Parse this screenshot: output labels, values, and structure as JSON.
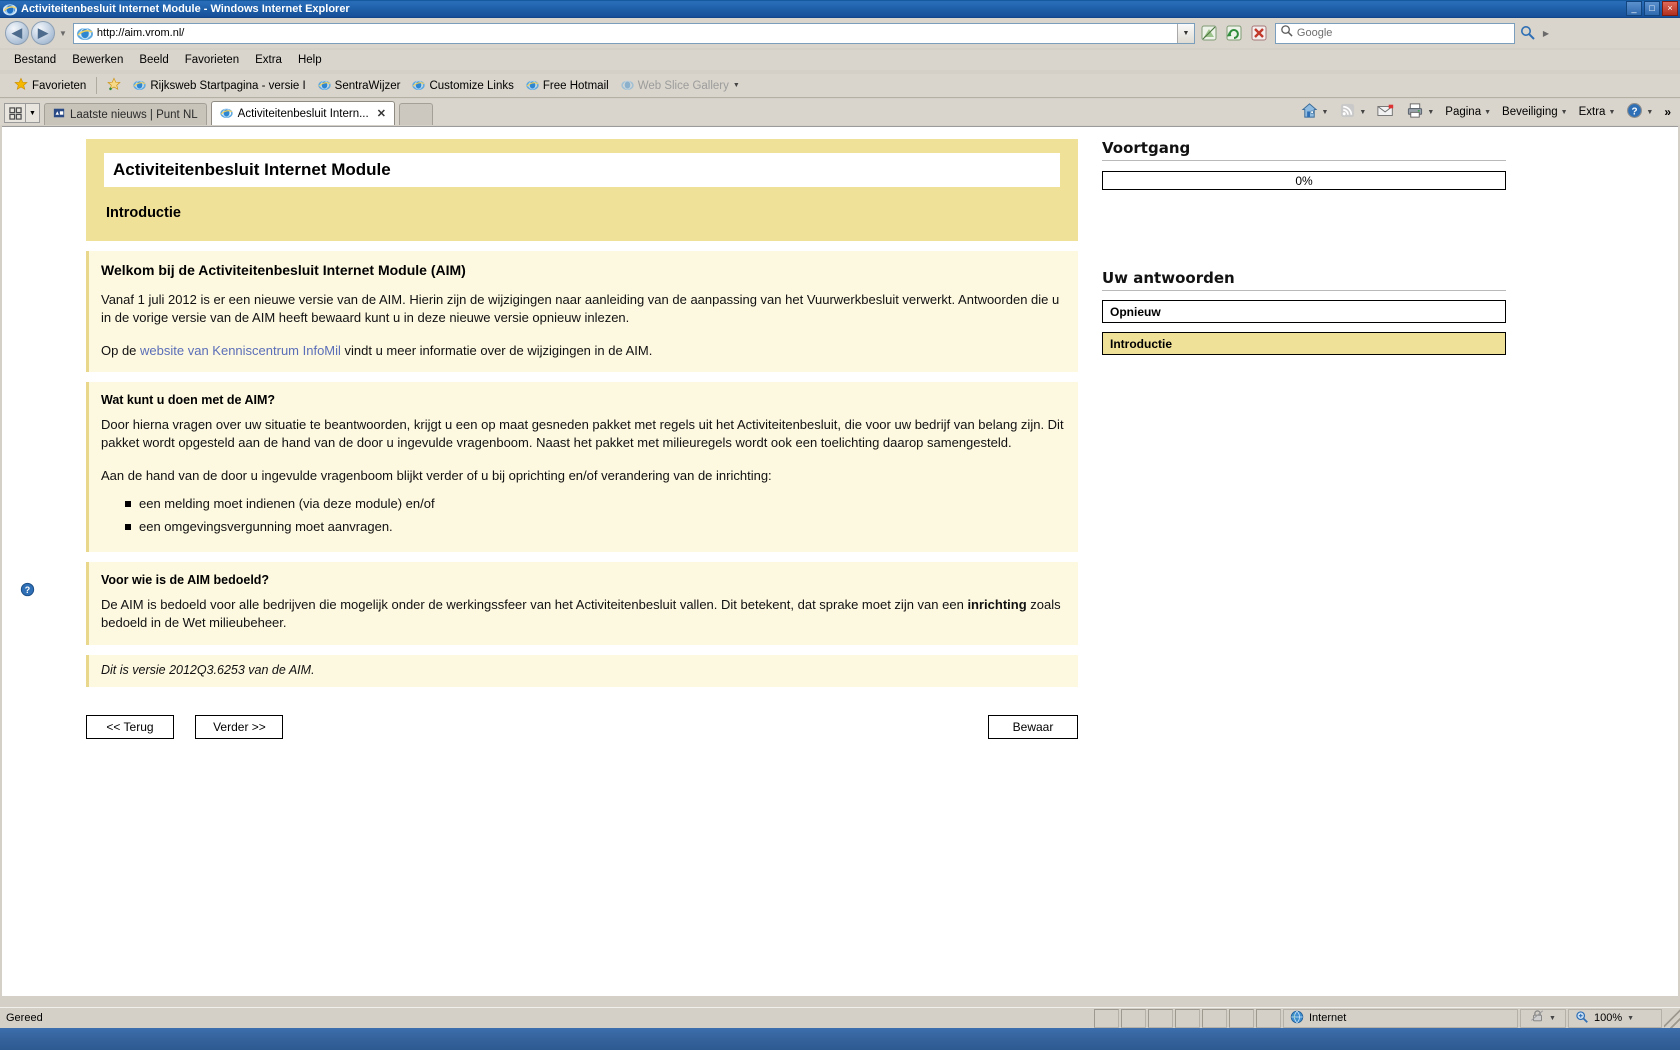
{
  "window": {
    "title": "Activiteitenbesluit Internet Module - Windows Internet Explorer",
    "minimize_label": "_",
    "maximize_label": "□",
    "close_label": "×"
  },
  "navigation": {
    "back_label": "◀",
    "forward_label": "▶",
    "recent_pages_caret": "▼",
    "url": "http://aim.vrom.nl/",
    "address_dropdown_caret": "▼",
    "compat_icon": "compatibility-view-icon",
    "refresh_icon": "refresh-icon",
    "stop_icon": "stop-icon",
    "search_placeholder": "Google",
    "search_go_caret": "▶"
  },
  "menubar": {
    "items": [
      {
        "label": "Bestand"
      },
      {
        "label": "Bewerken"
      },
      {
        "label": "Beeld"
      },
      {
        "label": "Favorieten"
      },
      {
        "label": "Extra"
      },
      {
        "label": "Help"
      }
    ]
  },
  "favoritesbar": {
    "favorites_label": "Favorieten",
    "items": [
      {
        "label": "Rijksweb Startpagina - versie I",
        "dim": false
      },
      {
        "label": "SentraWijzer",
        "dim": false
      },
      {
        "label": "Customize Links",
        "dim": false
      },
      {
        "label": "Free Hotmail",
        "dim": false
      },
      {
        "label": "Web Slice Gallery",
        "dim": true
      }
    ],
    "overflow_caret": "▼"
  },
  "tabbar": {
    "quicktabs_caret": "▼",
    "tabs": [
      {
        "label": "Laatste nieuws | Punt NL",
        "active": false
      },
      {
        "label": "Activiteitenbesluit Intern...",
        "active": true,
        "close_label": "✕"
      }
    ]
  },
  "commandbar": {
    "items": [
      {
        "name": "home-button",
        "label": "",
        "icon": "home-icon",
        "caret": "▼"
      },
      {
        "name": "feeds-button",
        "label": "",
        "icon": "rss-icon",
        "caret": "▼"
      },
      {
        "name": "read-mail-button",
        "label": "",
        "icon": "mail-icon",
        "caret": ""
      },
      {
        "name": "print-button",
        "label": "",
        "icon": "printer-icon",
        "caret": "▼"
      },
      {
        "name": "page-menu",
        "label": "Pagina",
        "icon": "",
        "caret": "▼"
      },
      {
        "name": "safety-menu",
        "label": "Beveiliging",
        "icon": "",
        "caret": "▼"
      },
      {
        "name": "tools-menu",
        "label": "Extra",
        "icon": "",
        "caret": "▼"
      },
      {
        "name": "help-menu",
        "label": "",
        "icon": "help-icon",
        "caret": "▼"
      }
    ],
    "overflow_label": "»"
  },
  "page": {
    "header": {
      "title": "Activiteitenbesluit Internet Module",
      "subtitle": "Introductie"
    },
    "welcome": {
      "heading": "Welkom bij de Activiteitenbesluit Internet Module (AIM)",
      "paragraph1": "Vanaf 1 juli 2012 is er een nieuwe versie van de AIM. Hierin zijn de wijzigingen naar aanleiding van de aanpassing van het Vuurwerkbesluit verwerkt. Antwoorden die u in de vorige versie van de AIM heeft bewaard kunt u in deze nieuwe versie opnieuw inlezen.",
      "paragraph2_pre": "Op de ",
      "paragraph2_link": "website van Kenniscentrum InfoMil",
      "paragraph2_post": " vindt u meer informatie over de wijzigingen in de AIM."
    },
    "what_can_you_do": {
      "heading": "Wat kunt u doen met de AIM?",
      "paragraph1": "Door hierna vragen over uw situatie te beantwoorden, krijgt u een op maat gesneden pakket met regels uit het Activiteitenbesluit, die voor uw bedrijf van belang zijn. Dit pakket wordt opgesteld aan de hand van de door u ingevulde vragenboom. Naast het pakket met milieuregels wordt ook een toelichting daarop samengesteld.",
      "paragraph2": "Aan de hand van de door u ingevulde vragenboom blijkt verder of u bij oprichting en/of verandering van de inrichting:",
      "bullets": [
        "een melding moet indienen (via deze module) en/of",
        "een omgevingsvergunning moet aanvragen."
      ]
    },
    "for_whom": {
      "heading": "Voor wie is de AIM bedoeld?",
      "text_pre": "De AIM is bedoeld voor alle bedrijven die mogelijk onder de werkingssfeer van het Activiteitenbesluit vallen. Dit betekent, dat sprake moet zijn van een ",
      "text_bold": "inrichting",
      "text_post": " zoals bedoeld in de Wet milieubeheer."
    },
    "version_note": "Dit is versie 2012Q3.6253 van de AIM.",
    "buttons": {
      "back": "<< Terug",
      "next": "Verder >>",
      "save": "Bewaar"
    },
    "help_icon": "help-question-icon"
  },
  "sidebar": {
    "progress_heading": "Voortgang",
    "progress_value": "0%",
    "answers_heading": "Uw antwoorden",
    "items": [
      {
        "label": "Opnieuw",
        "current": false
      },
      {
        "label": "Introductie",
        "current": true
      }
    ]
  },
  "statusbar": {
    "status_text": "Gereed",
    "zone_label": "Internet",
    "protected_caret": "▼",
    "zoom_label": "100%",
    "zoom_caret": "▼"
  },
  "colors": {
    "header_yellow": "#f0e199",
    "panel_cream": "#fdf8e0",
    "panel_border": "#e9d88b",
    "link_blue": "#5b6fb8",
    "title_blue": "#1e5fa8",
    "chrome_gray": "#d4d0c8"
  }
}
